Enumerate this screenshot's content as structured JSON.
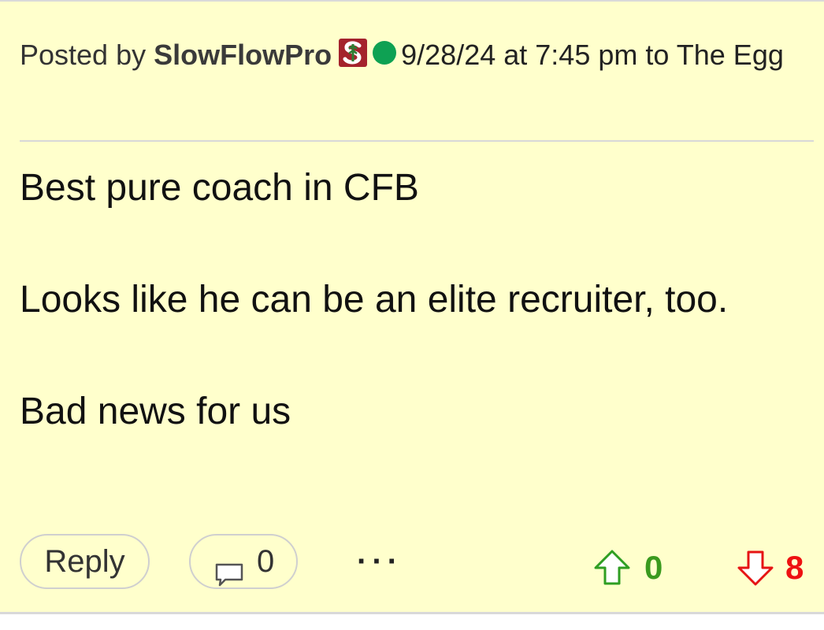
{
  "post": {
    "posted_by_label": "Posted by",
    "username": "SlowFlowPro",
    "team_logo_icon": "stanford-s-logo-icon",
    "online_status_icon": "online-dot-icon",
    "timestamp": "9/28/24 at 7:45 pm",
    "to_label": "to",
    "board": "The Egg",
    "body_lines": [
      "Best pure coach in CFB",
      "Looks like he can be an elite recruiter, too.",
      "Bad news for us"
    ]
  },
  "actions": {
    "reply_label": "Reply",
    "comment_icon": "comment-bubble-icon",
    "comment_count": "0",
    "more_label": "···",
    "upvote_icon": "arrow-up-icon",
    "upvote_count": "0",
    "downvote_icon": "arrow-down-icon",
    "downvote_count": "8"
  },
  "colors": {
    "background": "#ffffcc",
    "online": "#0ea153",
    "upvote": "#3a9a1e",
    "downvote": "#ee1111",
    "logo": "#a4232c"
  }
}
